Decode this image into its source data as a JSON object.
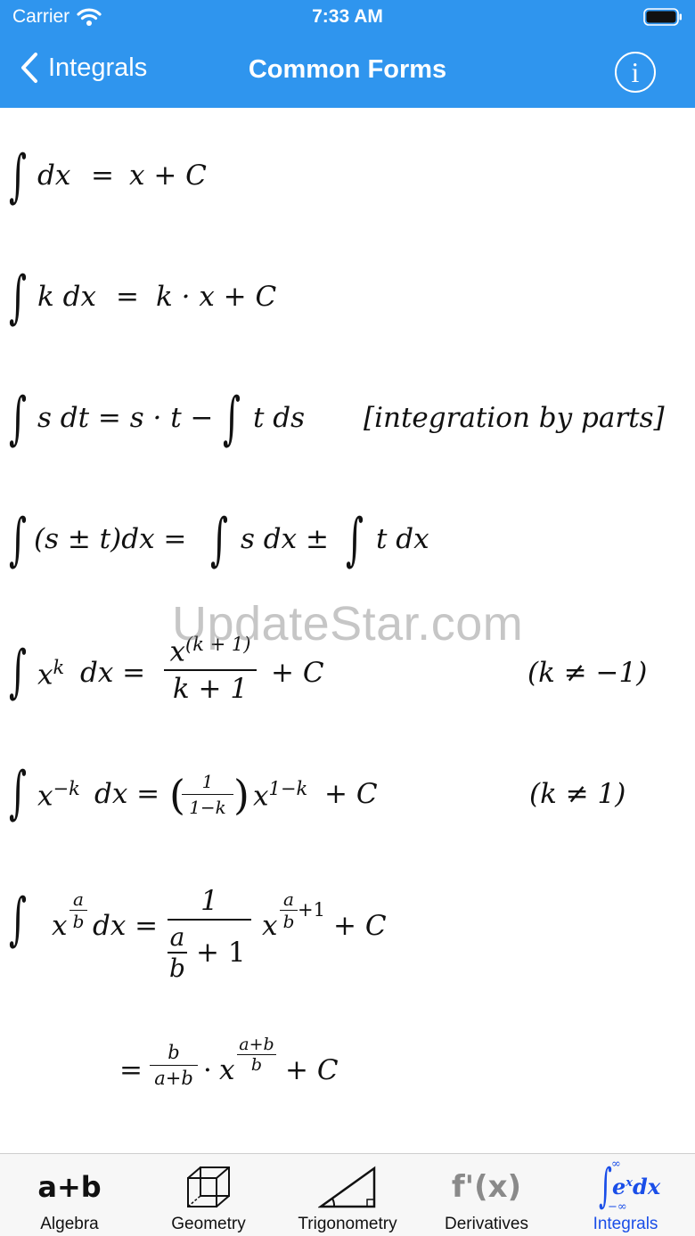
{
  "status_bar": {
    "carrier": "Carrier",
    "time": "7:33 AM"
  },
  "nav": {
    "back_label": "Integrals",
    "title": "Common Forms",
    "info_label": "i"
  },
  "watermark": "UpdateStar.com",
  "formulas": {
    "f1": {
      "integrand": "dx",
      "eq": "=",
      "rhs": "x + C"
    },
    "f2": {
      "integrand": "k dx",
      "eq": "=",
      "rhs": "k · x + C"
    },
    "f3": {
      "lhs": "s dt = s · t −",
      "rhs": "t ds",
      "note": "[integration by parts]"
    },
    "f4": {
      "lhs": "(s ± t)dx =",
      "mid": "s dx ±",
      "rhs": "t dx"
    },
    "f5": {
      "lhs_base": "x",
      "lhs_exp": "k",
      "lhs_dx": "dx =",
      "num": "x",
      "num_exp": "(k + 1)",
      "den": "k + 1",
      "tail": "+  C",
      "cond": "(k  ≠  −1)"
    },
    "f6": {
      "lhs_base": "x",
      "lhs_exp": "−k",
      "lhs_dx": "dx =",
      "paren_num": "1",
      "paren_den": "1−k",
      "base": "x",
      "exp": "1−k",
      "tail": "+  C",
      "cond": "(k  ≠  1)"
    },
    "f7": {
      "base": "x",
      "exp_num": "a",
      "exp_den": "b",
      "dx": "dx =",
      "num": "1",
      "den_frac_num": "a",
      "den_frac_den": "b",
      "den_tail": "+  1",
      "rbase": "x",
      "rexp_num": "a",
      "rexp_den": "b",
      "rexp_tail": "+1",
      "tail": "+  C"
    },
    "f8": {
      "eq": "=",
      "num": "b",
      "den": "a+b",
      "dot": "·",
      "base": "x",
      "exp_num": "a+b",
      "exp_den": "b",
      "tail": "+  C"
    }
  },
  "tabs": [
    {
      "label": "Algebra",
      "icon": "a+b"
    },
    {
      "label": "Geometry",
      "icon": "cube-icon"
    },
    {
      "label": "Trigonometry",
      "icon": "triangle-icon"
    },
    {
      "label": "Derivatives",
      "icon": "f'(x)"
    },
    {
      "label": "Integrals",
      "icon": "integral-icon",
      "icon_text": "e",
      "icon_sup": "x",
      "icon_dx": "dx",
      "icon_upper": "∞",
      "icon_lower": "−∞",
      "active": true
    }
  ],
  "colors": {
    "nav_bg": "#2f95ee",
    "active_tab": "#1a4ee8"
  }
}
